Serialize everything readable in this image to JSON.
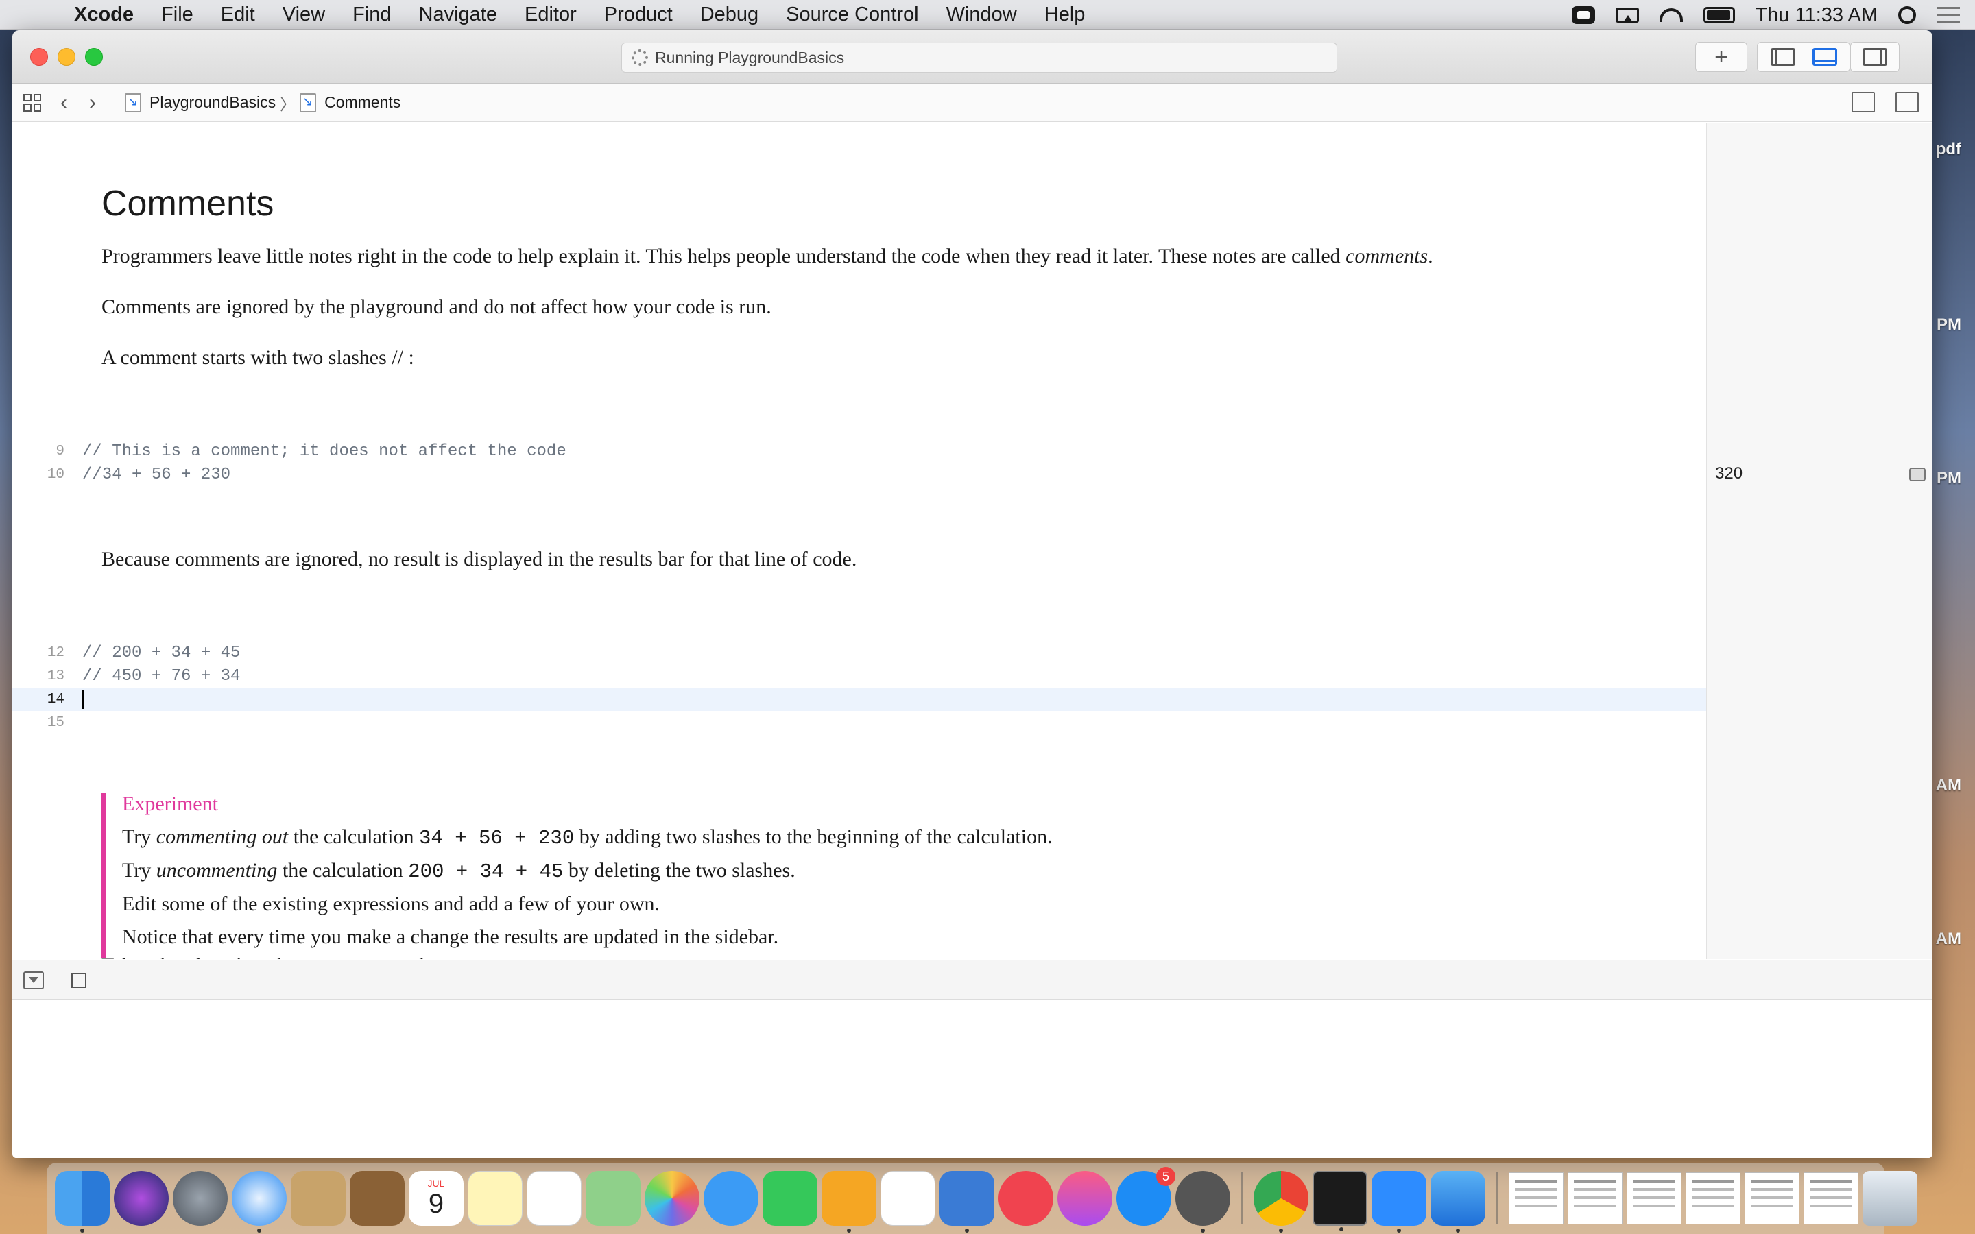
{
  "menubar": {
    "app_name": "Xcode",
    "items": [
      "File",
      "Edit",
      "View",
      "Find",
      "Navigate",
      "Editor",
      "Product",
      "Debug",
      "Source Control",
      "Window",
      "Help"
    ],
    "clock": "Thu 11:33 AM"
  },
  "desktop_labels": [
    "pdf",
    "PM",
    "PM",
    "AM",
    "AM"
  ],
  "window": {
    "activity_status": "Running PlaygroundBasics"
  },
  "jumpbar": {
    "project": "PlaygroundBasics",
    "page": "Comments"
  },
  "editor": {
    "heading": "Comments",
    "para1_a": "Programmers leave little notes right in the code to help explain it. This helps people understand the code when they read it later. These notes are called ",
    "para1_em": "comments",
    "para1_b": ".",
    "para2": "Comments are ignored by the playground and do not affect how your code is run.",
    "para3": "A comment starts with two slashes // :",
    "code_block_1": [
      {
        "line": "9",
        "text": "// This is a comment; it does not affect the code"
      },
      {
        "line": "10",
        "text": "//34 + 56 + 230"
      }
    ],
    "para4": "Because comments are ignored, no result is displayed in the results bar for that line of code.",
    "code_block_2": [
      {
        "line": "12",
        "text": "// 200 + 34 + 45"
      },
      {
        "line": "13",
        "text": "// 450 + 76 + 34"
      },
      {
        "line": "14",
        "text": ""
      },
      {
        "line": "15",
        "text": ""
      }
    ],
    "experiment": {
      "title": "Experiment",
      "l1_a": "Try ",
      "l1_em": "commenting out",
      "l1_b": " the calculation ",
      "l1_code": "34 + 56 + 230",
      "l1_c": " by adding two slashes to the beginning of the calculation.",
      "l2_a": "Try ",
      "l2_em": "uncommenting",
      "l2_b": " the calculation ",
      "l2_code": "200 + 34 + 45",
      "l2_c": " by deleting the two slashes.",
      "l3": "Edit some of the existing expressions and add a few of your own.",
      "l4": "Notice that every time you make a change the results are updated in the sidebar."
    },
    "cutoff_text": "Take a break and read your comments here"
  },
  "results_sidebar": {
    "value": "320"
  },
  "dock": {
    "app_store_badge": "5",
    "calendar_month": "JUL",
    "calendar_day": "9"
  }
}
